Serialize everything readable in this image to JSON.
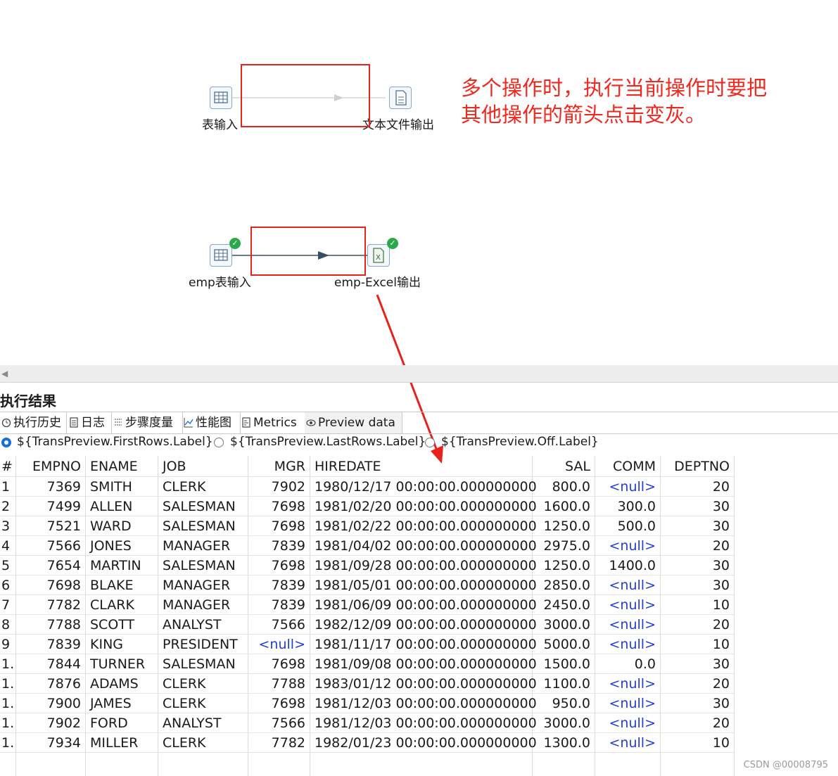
{
  "canvas": {
    "top_flow": {
      "from_label": "表输入",
      "to_label": "文本文件输出"
    },
    "bottom_flow": {
      "from_label": "emp表输入",
      "to_label": "emp-Excel输出"
    },
    "annotation_line1": "多个操作时，执行当前操作时要把",
    "annotation_line2": "其他操作的箭头点击变灰。",
    "annotation_color": "#f0281e"
  },
  "results": {
    "title": "执行结果",
    "tabs": [
      "执行历史",
      "日志",
      "步骤度量",
      "性能图",
      "Metrics",
      "Preview data"
    ],
    "active_tab": "Preview data",
    "radios": [
      "${TransPreview.FirstRows.Label}",
      "${TransPreview.LastRows.Label}",
      "${TransPreview.Off.Label}"
    ],
    "selected_radio": "${TransPreview.FirstRows.Label}"
  },
  "table": {
    "columns": [
      "#",
      "EMPNO",
      "ENAME",
      "JOB",
      "MGR",
      "HIREDATE",
      "SAL",
      "COMM",
      "DEPTNO"
    ],
    "rows": [
      [
        "1",
        "7369",
        "SMITH",
        "CLERK",
        "7902",
        "1980/12/17 00:00:00.000000000",
        "800.0",
        "<null>",
        "20"
      ],
      [
        "2",
        "7499",
        "ALLEN",
        "SALESMAN",
        "7698",
        "1981/02/20 00:00:00.000000000",
        "1600.0",
        "300.0",
        "30"
      ],
      [
        "3",
        "7521",
        "WARD",
        "SALESMAN",
        "7698",
        "1981/02/22 00:00:00.000000000",
        "1250.0",
        "500.0",
        "30"
      ],
      [
        "4",
        "7566",
        "JONES",
        "MANAGER",
        "7839",
        "1981/04/02 00:00:00.000000000",
        "2975.0",
        "<null>",
        "20"
      ],
      [
        "5",
        "7654",
        "MARTIN",
        "SALESMAN",
        "7698",
        "1981/09/28 00:00:00.000000000",
        "1250.0",
        "1400.0",
        "30"
      ],
      [
        "6",
        "7698",
        "BLAKE",
        "MANAGER",
        "7839",
        "1981/05/01 00:00:00.000000000",
        "2850.0",
        "<null>",
        "30"
      ],
      [
        "7",
        "7782",
        "CLARK",
        "MANAGER",
        "7839",
        "1981/06/09 00:00:00.000000000",
        "2450.0",
        "<null>",
        "10"
      ],
      [
        "8",
        "7788",
        "SCOTT",
        "ANALYST",
        "7566",
        "1982/12/09 00:00:00.000000000",
        "3000.0",
        "<null>",
        "20"
      ],
      [
        "9",
        "7839",
        "KING",
        "PRESIDENT",
        "<null>",
        "1981/11/17 00:00:00.000000000",
        "5000.0",
        "<null>",
        "10"
      ],
      [
        "1.",
        "7844",
        "TURNER",
        "SALESMAN",
        "7698",
        "1981/09/08 00:00:00.000000000",
        "1500.0",
        "0.0",
        "30"
      ],
      [
        "1.",
        "7876",
        "ADAMS",
        "CLERK",
        "7788",
        "1983/01/12 00:00:00.000000000",
        "1100.0",
        "<null>",
        "20"
      ],
      [
        "1.",
        "7900",
        "JAMES",
        "CLERK",
        "7698",
        "1981/12/03 00:00:00.000000000",
        "950.0",
        "<null>",
        "30"
      ],
      [
        "1.",
        "7902",
        "FORD",
        "ANALYST",
        "7566",
        "1981/12/03 00:00:00.000000000",
        "3000.0",
        "<null>",
        "20"
      ],
      [
        "1.",
        "7934",
        "MILLER",
        "CLERK",
        "7782",
        "1982/01/23 00:00:00.000000000",
        "1300.0",
        "<null>",
        "10"
      ]
    ],
    "null_color": "#1f3fd0"
  },
  "watermark": "CSDN @00008795"
}
